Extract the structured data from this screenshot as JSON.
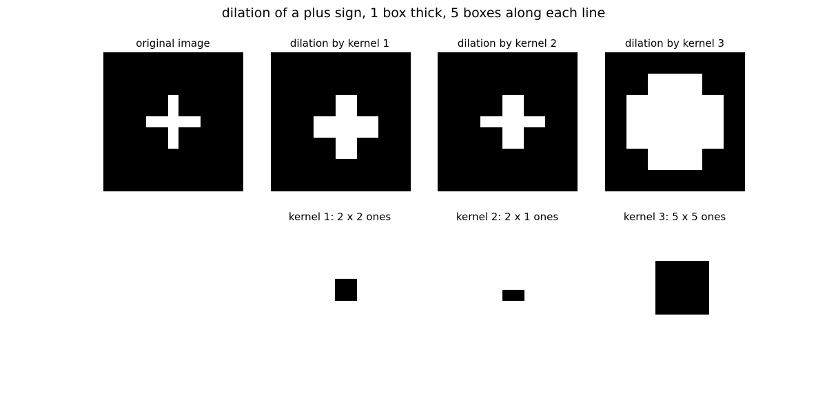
{
  "figure": {
    "title": "dilation of a plus sign, 1 box thick, 5 boxes along each line"
  },
  "colors": {
    "background": "#000000",
    "foreground": "#ffffff",
    "kernel_fill": "#000000"
  },
  "images": [
    {
      "title": "original image",
      "grid_size": 13,
      "cells": [
        [
          6,
          4
        ],
        [
          6,
          5
        ],
        [
          6,
          6
        ],
        [
          6,
          7
        ],
        [
          6,
          8
        ],
        [
          4,
          6
        ],
        [
          5,
          6
        ],
        [
          7,
          6
        ],
        [
          8,
          6
        ]
      ]
    },
    {
      "title": "dilation by kernel 1",
      "grid_size": 13,
      "cells": [
        [
          4,
          6
        ],
        [
          4,
          7
        ],
        [
          5,
          6
        ],
        [
          5,
          7
        ],
        [
          6,
          4
        ],
        [
          6,
          5
        ],
        [
          6,
          6
        ],
        [
          6,
          7
        ],
        [
          6,
          8
        ],
        [
          6,
          9
        ],
        [
          7,
          4
        ],
        [
          7,
          5
        ],
        [
          7,
          6
        ],
        [
          7,
          7
        ],
        [
          7,
          8
        ],
        [
          7,
          9
        ],
        [
          8,
          6
        ],
        [
          8,
          7
        ],
        [
          9,
          6
        ],
        [
          9,
          7
        ]
      ]
    },
    {
      "title": "dilation by kernel 2",
      "grid_size": 13,
      "cells": [
        [
          4,
          6
        ],
        [
          4,
          7
        ],
        [
          5,
          6
        ],
        [
          5,
          7
        ],
        [
          6,
          4
        ],
        [
          6,
          5
        ],
        [
          6,
          6
        ],
        [
          6,
          7
        ],
        [
          6,
          8
        ],
        [
          6,
          9
        ],
        [
          7,
          6
        ],
        [
          7,
          7
        ],
        [
          8,
          6
        ],
        [
          8,
          7
        ]
      ]
    },
    {
      "title": "dilation by kernel 3",
      "grid_size": 13,
      "cells": [
        [
          2,
          4
        ],
        [
          2,
          5
        ],
        [
          2,
          6
        ],
        [
          2,
          7
        ],
        [
          2,
          8
        ],
        [
          3,
          4
        ],
        [
          3,
          5
        ],
        [
          3,
          6
        ],
        [
          3,
          7
        ],
        [
          3,
          8
        ],
        [
          4,
          2
        ],
        [
          4,
          3
        ],
        [
          4,
          4
        ],
        [
          4,
          5
        ],
        [
          4,
          6
        ],
        [
          4,
          7
        ],
        [
          4,
          8
        ],
        [
          4,
          9
        ],
        [
          4,
          10
        ],
        [
          5,
          2
        ],
        [
          5,
          3
        ],
        [
          5,
          4
        ],
        [
          5,
          5
        ],
        [
          5,
          6
        ],
        [
          5,
          7
        ],
        [
          5,
          8
        ],
        [
          5,
          9
        ],
        [
          5,
          10
        ],
        [
          6,
          2
        ],
        [
          6,
          3
        ],
        [
          6,
          4
        ],
        [
          6,
          5
        ],
        [
          6,
          6
        ],
        [
          6,
          7
        ],
        [
          6,
          8
        ],
        [
          6,
          9
        ],
        [
          6,
          10
        ],
        [
          7,
          2
        ],
        [
          7,
          3
        ],
        [
          7,
          4
        ],
        [
          7,
          5
        ],
        [
          7,
          6
        ],
        [
          7,
          7
        ],
        [
          7,
          8
        ],
        [
          7,
          9
        ],
        [
          7,
          10
        ],
        [
          8,
          2
        ],
        [
          8,
          3
        ],
        [
          8,
          4
        ],
        [
          8,
          5
        ],
        [
          8,
          6
        ],
        [
          8,
          7
        ],
        [
          8,
          8
        ],
        [
          8,
          9
        ],
        [
          8,
          10
        ],
        [
          9,
          4
        ],
        [
          9,
          5
        ],
        [
          9,
          6
        ],
        [
          9,
          7
        ],
        [
          9,
          8
        ],
        [
          10,
          4
        ],
        [
          10,
          5
        ],
        [
          10,
          6
        ],
        [
          10,
          7
        ],
        [
          10,
          8
        ]
      ]
    }
  ],
  "kernels": [
    {
      "title": "kernel 1: 2 x 2 ones",
      "rows": 2,
      "cols": 2
    },
    {
      "title": "kernel 2: 2 x 1 ones",
      "rows": 1,
      "cols": 2
    },
    {
      "title": "kernel 3: 5 x 5 ones",
      "rows": 5,
      "cols": 5
    }
  ]
}
